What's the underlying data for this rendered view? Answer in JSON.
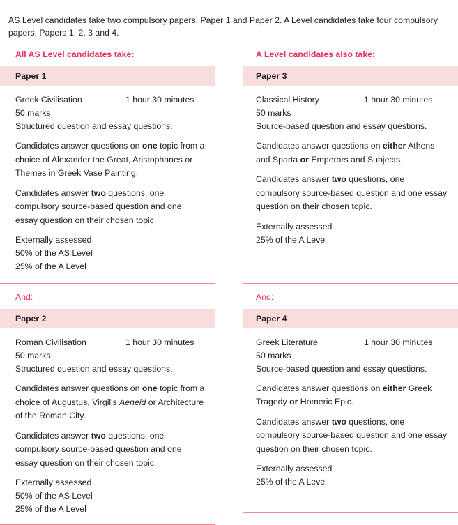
{
  "intro": "AS Level candidates take two compulsory papers, Paper 1 and Paper 2. A Level candidates take four compulsory papers, Papers 1, 2, 3 and 4.",
  "colors": {
    "accent_pink": "#e8305b",
    "header_bar": "#f9dcdc",
    "rule": "#ef8a92",
    "body_text": "#231f20"
  },
  "left_column": {
    "heading": "All AS Level candidates take:",
    "and_label": "And:",
    "papers": [
      {
        "bar_title": "Paper 1",
        "subject": "Greek Civilisation",
        "duration": "1 hour 30 minutes",
        "marks": "50 marks",
        "format": "Structured question and essay questions.",
        "topic_choice_prefix": "Candidates answer questions on ",
        "topic_choice_bold": "one",
        "topic_choice_suffix": " topic from a choice of Alexander the Great, Aristophanes or Themes in Greek Vase Painting.",
        "questions_prefix": "Candidates answer ",
        "questions_bold": "two",
        "questions_suffix": " questions, one compulsory source-based question and one essay question on their chosen topic.",
        "assessment": "Externally assessed",
        "weight_as": "50% of the AS Level",
        "weight_a": "25% of the A Level"
      },
      {
        "bar_title": "Paper 2",
        "subject": "Roman Civilisation",
        "duration": "1 hour 30 minutes",
        "marks": "50 marks",
        "format": "Structured question and essay questions.",
        "topic_choice_prefix": "Candidates answer questions on ",
        "topic_choice_bold": "one",
        "topic_choice_mid": " topic from a choice of Augustus, Virgil's ",
        "topic_choice_italic": "Aeneid",
        "topic_choice_suffix": " or Architecture of the Roman City.",
        "questions_prefix": "Candidates answer ",
        "questions_bold": "two",
        "questions_suffix": " questions, one compulsory source-based question and one essay question on their chosen topic.",
        "assessment": "Externally assessed",
        "weight_as": "50% of the AS Level",
        "weight_a": "25% of the A Level"
      }
    ]
  },
  "right_column": {
    "heading": "A Level candidates also take:",
    "and_label": "And:",
    "papers": [
      {
        "bar_title": "Paper 3",
        "subject": "Classical History",
        "duration": "1 hour 30 minutes",
        "marks": "50 marks",
        "format": "Source-based question and essay questions.",
        "topic_choice_prefix": "Candidates answer questions on ",
        "topic_choice_bold1": "either",
        "topic_choice_mid": " Athens and Sparta ",
        "topic_choice_bold2": "or",
        "topic_choice_suffix": " Emperors and Subjects.",
        "questions_prefix": "Candidates answer ",
        "questions_bold": "two",
        "questions_suffix": " questions, one compulsory source-based question and one essay question on their chosen topic.",
        "assessment": "Externally assessed",
        "weight_a": "25% of the A Level"
      },
      {
        "bar_title": "Paper 4",
        "subject": "Greek Literature",
        "duration": "1 hour 30 minutes",
        "marks": "50 marks",
        "format": "Source-based question and essay questions.",
        "topic_choice_prefix": "Candidates answer questions on ",
        "topic_choice_bold1": "either",
        "topic_choice_mid": " Greek Tragedy ",
        "topic_choice_bold2": "or",
        "topic_choice_suffix": " Homeric Epic.",
        "questions_prefix": "Candidates answer ",
        "questions_bold": "two",
        "questions_suffix": " questions, one compulsory source-based question and one essay question on their chosen topic.",
        "assessment": "Externally assessed",
        "weight_a": "25% of the A Level"
      }
    ]
  }
}
